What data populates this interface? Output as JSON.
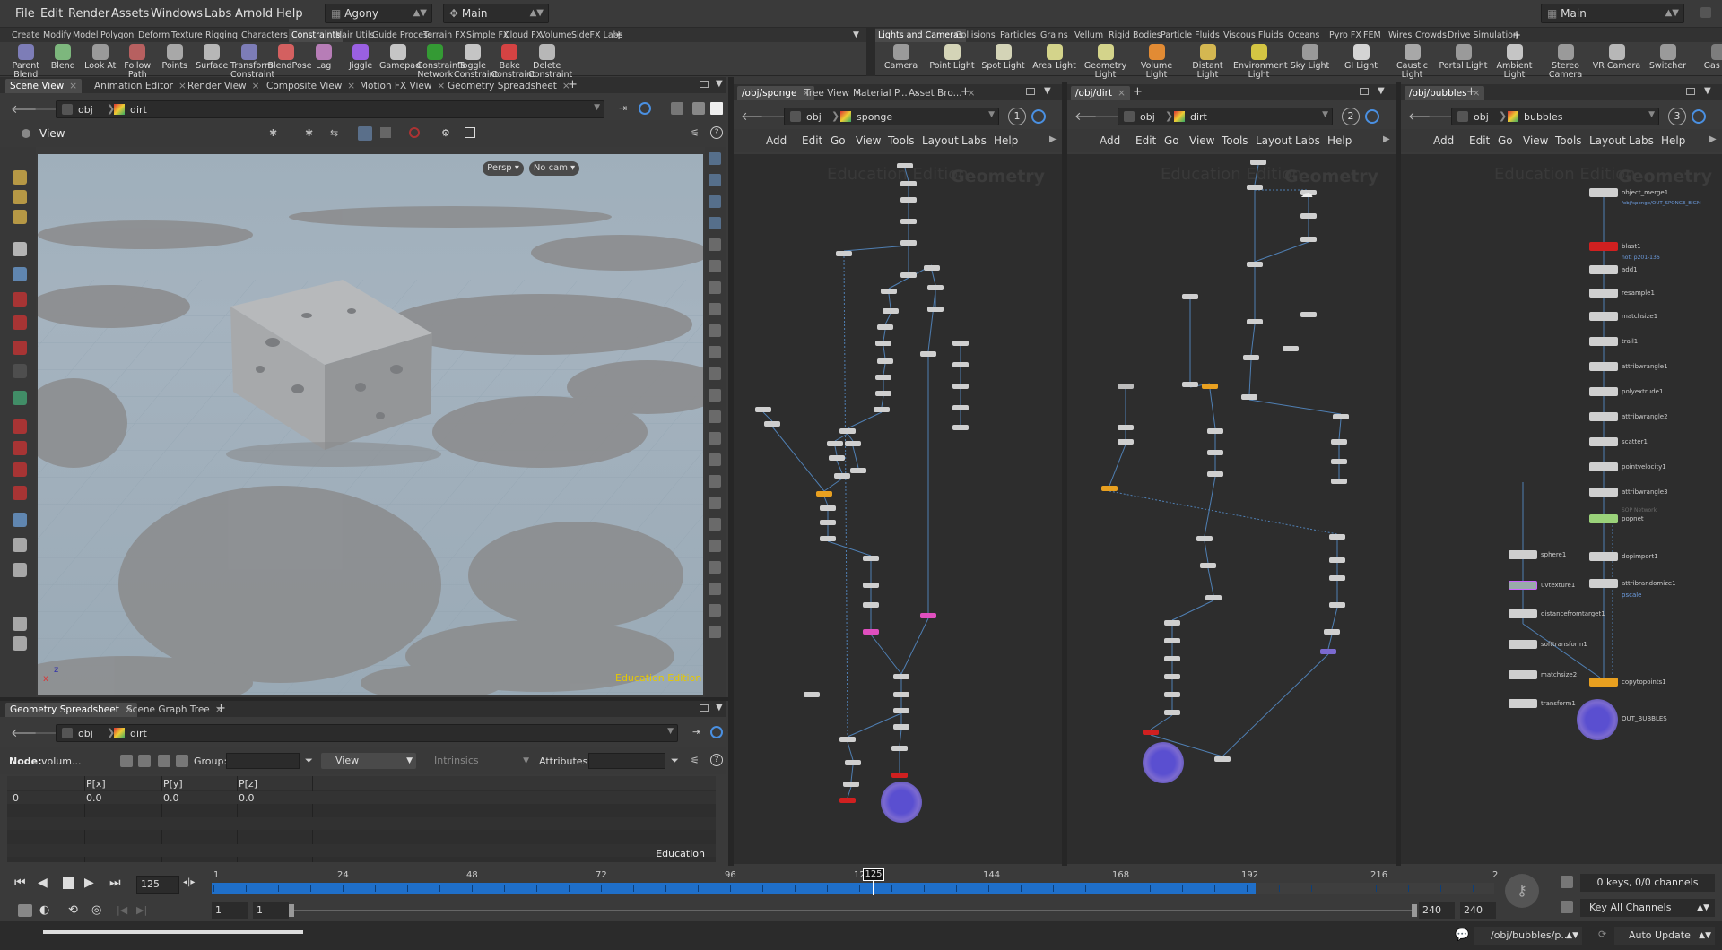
{
  "menu": {
    "items": [
      "File",
      "Edit",
      "Render",
      "Assets",
      "Windows",
      "Labs",
      "Arnold",
      "Help"
    ],
    "desktop": "Agony",
    "context": "Main",
    "right_context": "Main"
  },
  "shelf_left": {
    "tabs": [
      "Create",
      "Modify",
      "Model",
      "Polygon",
      "Deform",
      "Texture",
      "Rigging",
      "Characters",
      "Constraints",
      "Hair Utils",
      "Guide Process",
      "Terrain FX",
      "Simple FX",
      "Cloud FX",
      "Volume",
      "SideFX Labs"
    ],
    "active": "Constraints",
    "tools": [
      "Parent Blend",
      "Blend",
      "Look At",
      "Follow Path",
      "Points",
      "Surface",
      "Transform Constraint",
      "BlendPose",
      "Lag",
      "Jiggle",
      "Gamepad",
      "Constraints Network",
      "Toggle Constraint",
      "Bake Constraint",
      "Delete Constraint"
    ]
  },
  "shelf_right": {
    "tabs": [
      "Lights and Cameras",
      "Collisions",
      "Particles",
      "Grains",
      "Vellum",
      "Rigid Bodies",
      "Particle Fluids",
      "Viscous Fluids",
      "Oceans",
      "Pyro FX",
      "FEM",
      "Wires",
      "Crowds",
      "Drive Simulation"
    ],
    "active": "Lights and Cameras",
    "tools": [
      "Camera",
      "Point Light",
      "Spot Light",
      "Area Light",
      "Geometry Light",
      "Volume Light",
      "Distant Light",
      "Environment Light",
      "Sky Light",
      "GI Light",
      "Caustic Light",
      "Portal Light",
      "Ambient Light",
      "Stereo Camera",
      "VR Camera",
      "Switcher",
      "Gas Ca"
    ]
  },
  "viewer": {
    "tabs": [
      "Scene View",
      "Animation Editor",
      "Render View",
      "Composite View",
      "Motion FX View",
      "Geometry Spreadsheet"
    ],
    "path_root": "obj",
    "path_node": "dirt",
    "title": "View",
    "persp": "Persp",
    "cam": "No cam",
    "edition": "Education Edition"
  },
  "spreadsheet": {
    "tabs": [
      "Geometry Spreadsheet",
      "Scene Graph Tree"
    ],
    "path_root": "obj",
    "path_node": "dirt",
    "node_label": "Node:",
    "node_value": "volum...",
    "group_label": "Group:",
    "view": "View",
    "intrinsics": "Intrinsics",
    "attributes_label": "Attributes:",
    "columns": [
      "",
      "P[x]",
      "P[y]",
      "P[z]"
    ],
    "rows": [
      [
        "0",
        "0.0",
        "0.0",
        "0.0"
      ]
    ],
    "edition": "Education"
  },
  "net1": {
    "tabs": [
      "/obj/sponge",
      "Tree View",
      "Material P...",
      "Asset Bro..."
    ],
    "root": "obj",
    "node": "sponge",
    "num": "1",
    "menu": [
      "Add",
      "Edit",
      "Go",
      "View",
      "Tools",
      "Layout",
      "Labs",
      "Help"
    ],
    "wm_edu": "Education Edition",
    "wm_geo": "Geometry"
  },
  "net2": {
    "tabs": [
      "/obj/dirt"
    ],
    "root": "obj",
    "node": "dirt",
    "num": "2",
    "menu": [
      "Add",
      "Edit",
      "Go",
      "View",
      "Tools",
      "Layout",
      "Labs",
      "Help"
    ],
    "wm_edu": "Education Edition",
    "wm_geo": "Geometry"
  },
  "net3": {
    "tabs": [
      "/obj/bubbles"
    ],
    "root": "obj",
    "node": "bubbles",
    "num": "3",
    "menu": [
      "Add",
      "Edit",
      "Go",
      "View",
      "Tools",
      "Layout",
      "Labs",
      "Help"
    ],
    "wm_edu": "Education Edition",
    "wm_geo": "Geometry",
    "chain": [
      "object_merge1",
      "blast1",
      "add1",
      "resample1",
      "matchsize1",
      "trail1",
      "attribwrangle1",
      "polyextrude1",
      "attribwrangle2",
      "scatter1",
      "pointvelocity1",
      "attribwrangle3",
      "popnet",
      "dopimport1",
      "attribrandomize1",
      "copytopoints1",
      "OUT_BUBBLES"
    ],
    "side": [
      "sphere1",
      "uvtexture1",
      "distancefromtarget1",
      "softtransform1",
      "matchsize2",
      "transform1"
    ],
    "notes": {
      "merge_path": "/obj/sponge/OUT_SPONGE_BIGM",
      "blast_group": "not: p201-136",
      "pscale": "pscale",
      "sop_network": "SOP Network"
    }
  },
  "timeline": {
    "frame": "125",
    "ticks": [
      "1",
      "24",
      "48",
      "72",
      "96",
      "120",
      "144",
      "168",
      "192",
      "216",
      "2"
    ],
    "current_marker": "125",
    "start": "1",
    "start2": "1",
    "end": "240",
    "end2": "240",
    "keys": "0 keys, 0/0 channels",
    "key_all": "Key All Channels"
  },
  "status": {
    "path": "/obj/bubbles/p...",
    "auto_update": "Auto Update"
  },
  "colors": {
    "accent_blue": "#1f6fc9",
    "orange": "#e8a020",
    "red": "#d02020",
    "purple": "#7b6ad0"
  }
}
